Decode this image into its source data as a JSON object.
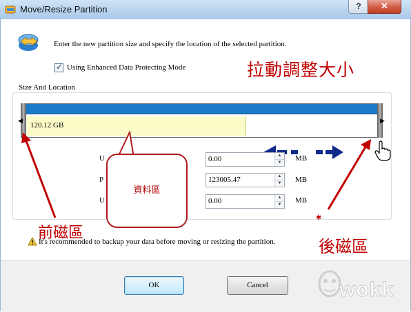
{
  "window": {
    "title": "Move/Resize Partition",
    "help_label": "?",
    "close_label": "✕"
  },
  "instruction": "Enter the new partition size and specify the location of the selected partition.",
  "protect_mode": {
    "label": "Using Enhanced Data Protecting Mode",
    "checked": true
  },
  "group": {
    "label": "Size And Location"
  },
  "partition_bar": {
    "size_label": "120.12 GB",
    "used_fraction": 0.62
  },
  "fields": [
    {
      "label": "U",
      "value": "0.00",
      "unit": "MB"
    },
    {
      "label": "P",
      "value": "123005.47",
      "unit": "MB"
    },
    {
      "label": "U",
      "value": "0.00",
      "unit": "MB"
    }
  ],
  "warning": {
    "text": "It's recommended to backup your data before moving or resizing the partition."
  },
  "buttons": {
    "ok": "OK",
    "cancel": "Cancel"
  },
  "annotations": {
    "resize": "拉動調整大小",
    "front": "前磁區",
    "back": "後磁區",
    "data_area": "資料區",
    "color": "#c00000"
  },
  "watermark": "wokk"
}
